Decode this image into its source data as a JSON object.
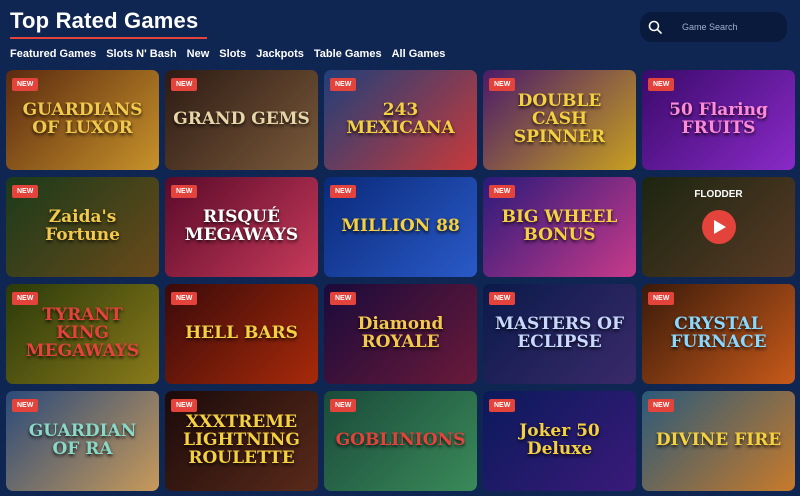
{
  "header": {
    "title": "Top Rated Games"
  },
  "search": {
    "placeholder": "Game Search"
  },
  "tabs": [
    {
      "label": "Featured Games"
    },
    {
      "label": "Slots N' Bash"
    },
    {
      "label": "New"
    },
    {
      "label": "Slots"
    },
    {
      "label": "Jackpots"
    },
    {
      "label": "Table Games"
    },
    {
      "label": "All Games"
    }
  ],
  "badge_label": "NEW",
  "games": [
    {
      "title": "GUARDIANS OF LUXOR",
      "new": true,
      "colors": [
        "#5a2a10",
        "#c8922a"
      ],
      "text_color": "#f2c94c"
    },
    {
      "title": "GRAND GEMS",
      "new": true,
      "colors": [
        "#2d1a14",
        "#7a5a3a"
      ],
      "text_color": "#e8d5a8"
    },
    {
      "title": "243 MEXICANA",
      "new": true,
      "colors": [
        "#1f3f7a",
        "#c83a3a"
      ],
      "text_color": "#f5d040"
    },
    {
      "title": "DOUBLE CASH SPINNER",
      "new": true,
      "colors": [
        "#4a1a6a",
        "#c8a020"
      ],
      "text_color": "#f5d040"
    },
    {
      "title": "50 Flaring FRUITS",
      "new": true,
      "colors": [
        "#3a0a6a",
        "#8a2ac8"
      ],
      "text_color": "#ff8ad8"
    },
    {
      "title": "Zaida's Fortune",
      "new": true,
      "colors": [
        "#1a3a1a",
        "#6a4a1a"
      ],
      "text_color": "#f2c94c"
    },
    {
      "title": "RISQUÉ MEGAWAYS",
      "new": true,
      "colors": [
        "#5a0a2a",
        "#c83a5a"
      ],
      "text_color": "#ffffff"
    },
    {
      "title": "MILLION 88",
      "new": true,
      "colors": [
        "#0a2a7a",
        "#2a5ac8"
      ],
      "text_color": "#f5d040"
    },
    {
      "title": "BIG WHEEL BONUS",
      "new": true,
      "colors": [
        "#2a1a7a",
        "#c83a8a"
      ],
      "text_color": "#f5d040"
    },
    {
      "title": "FLODDER",
      "new": false,
      "video": true,
      "colors": [
        "#2a3a1a",
        "#8a5a3a"
      ],
      "text_color": "#ffffff"
    },
    {
      "title": "TYRANT KING MEGAWAYS",
      "new": true,
      "colors": [
        "#2a3a0a",
        "#8a7a1a"
      ],
      "text_color": "#e3433b"
    },
    {
      "title": "HELL BARS",
      "new": true,
      "colors": [
        "#3a0a0a",
        "#a82a0a"
      ],
      "text_color": "#f5d040"
    },
    {
      "title": "Diamond ROYALE",
      "new": true,
      "colors": [
        "#1a0a3a",
        "#6a1a3a"
      ],
      "text_color": "#f2c94c"
    },
    {
      "title": "MASTERS OF ECLIPSE",
      "new": true,
      "colors": [
        "#0a1a4a",
        "#3a2a6a"
      ],
      "text_color": "#c8d8ff"
    },
    {
      "title": "CRYSTAL FURNACE",
      "new": true,
      "colors": [
        "#3a1a0a",
        "#c85a1a"
      ],
      "text_color": "#8ad8ff"
    },
    {
      "title": "GUARDIAN OF RA",
      "new": true,
      "colors": [
        "#2a4a7a",
        "#c89a5a"
      ],
      "text_color": "#8ad8c8"
    },
    {
      "title": "XXXTREME LIGHTNING ROULETTE",
      "new": true,
      "colors": [
        "#1a0a0a",
        "#5a2a1a"
      ],
      "text_color": "#f5d040"
    },
    {
      "title": "GOBLINIONS",
      "new": true,
      "colors": [
        "#1a4a3a",
        "#3a8a5a"
      ],
      "text_color": "#e3433b"
    },
    {
      "title": "Joker 50 Deluxe",
      "new": true,
      "colors": [
        "#0a1a5a",
        "#3a1a7a"
      ],
      "text_color": "#f5d040"
    },
    {
      "title": "DIVINE FIRE",
      "new": true,
      "colors": [
        "#2a5a7a",
        "#c87a2a"
      ],
      "text_color": "#f5d040"
    }
  ]
}
